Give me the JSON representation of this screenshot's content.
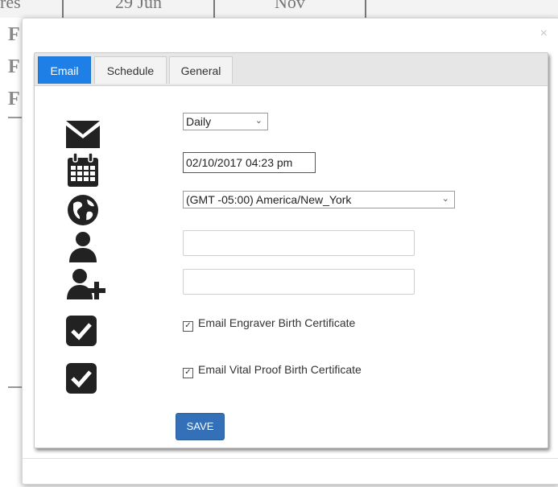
{
  "background": {
    "row_cells": [
      "res",
      "29 Jun",
      "Nov"
    ],
    "side_letters": [
      "F",
      "F",
      "F"
    ]
  },
  "modal": {
    "close_glyph": "×"
  },
  "tabs": [
    {
      "label": "Email",
      "active": true
    },
    {
      "label": "Schedule",
      "active": false
    },
    {
      "label": "General",
      "active": false
    }
  ],
  "form": {
    "frequency": {
      "value": "Daily"
    },
    "datetime": {
      "value": "02/10/2017 04:23 pm"
    },
    "timezone": {
      "value": "(GMT -05:00) America/New_York"
    },
    "recipient_1": {
      "value": ""
    },
    "recipient_2": {
      "value": ""
    },
    "check_engraver": {
      "label": "Email Engraver Birth Certificate",
      "checked": true
    },
    "check_vital": {
      "label": "Email Vital Proof Birth Certificate",
      "checked": true
    },
    "save_label": "SAVE"
  },
  "icons": [
    "envelope-icon",
    "calendar-icon",
    "globe-icon",
    "user-icon",
    "add-user-icon",
    "checkbox-icon",
    "checkbox-icon"
  ],
  "colors": {
    "accent": "#1e80e6",
    "save": "#3370b8",
    "icon": "#222222"
  }
}
